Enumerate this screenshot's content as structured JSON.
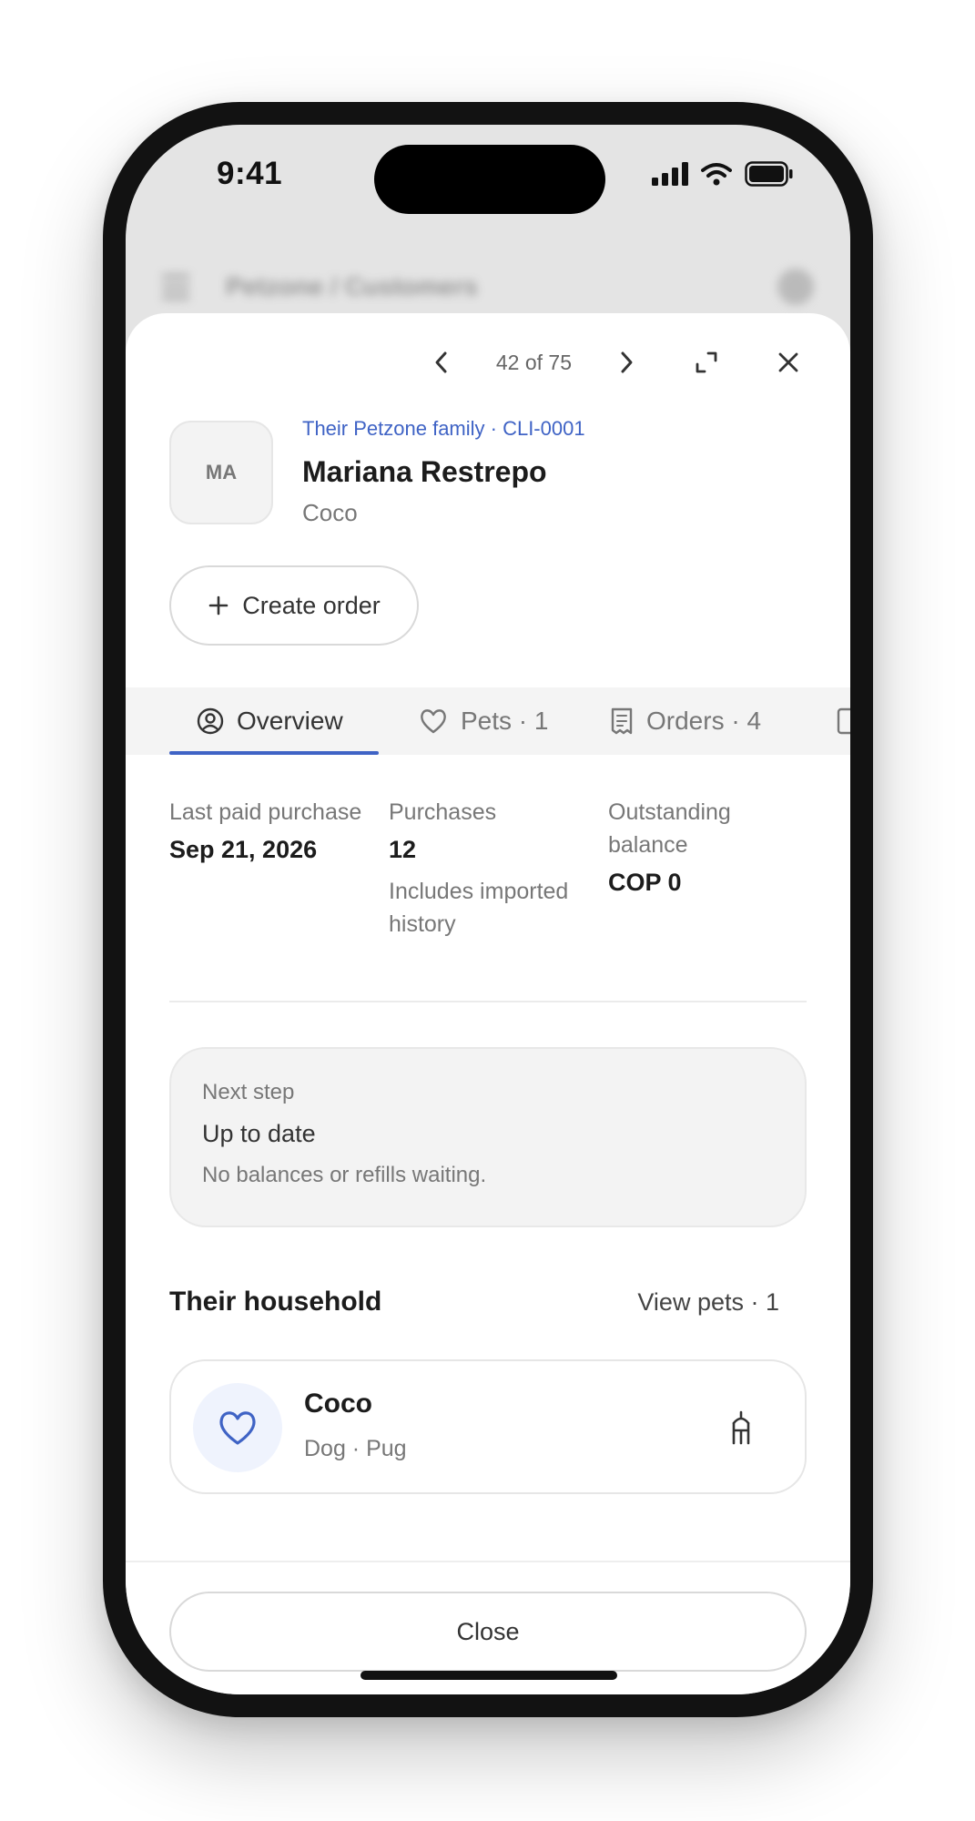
{
  "status_bar": {
    "time": "9:41"
  },
  "background_header": {
    "breadcrumb": "Petzone / Customers"
  },
  "sheet_nav": {
    "counter": "42 of 75"
  },
  "customer": {
    "initials": "MA",
    "family_line": "Their Petzone family · CLI-0001",
    "name": "Mariana Restrepo",
    "pet_summary": "Coco"
  },
  "actions": {
    "create_order_label": "Create order",
    "close_label": "Close"
  },
  "tabs": [
    {
      "label": "Overview",
      "icon": "user-circle-icon",
      "active": true
    },
    {
      "label": "Pets · 1",
      "icon": "heart-icon",
      "active": false
    },
    {
      "label": "Orders · 4",
      "icon": "receipt-icon",
      "active": false
    }
  ],
  "stats": [
    {
      "label": "Last paid purchase",
      "value": "Sep 21, 2026",
      "note": ""
    },
    {
      "label": "Purchases",
      "value": "12",
      "note": "Includes imported history"
    },
    {
      "label": "Outstanding balance",
      "value": "COP 0",
      "note": ""
    }
  ],
  "next_step": {
    "label": "Next step",
    "title": "Up to date",
    "subtitle": "No balances or refills waiting."
  },
  "household": {
    "title": "Their household",
    "view_pets_label": "View pets · 1",
    "pets": [
      {
        "name": "Coco",
        "details": "Dog · Pug"
      }
    ]
  },
  "colors": {
    "accent": "#3f63c5",
    "pet_icon_bg": "#eff3fd"
  }
}
